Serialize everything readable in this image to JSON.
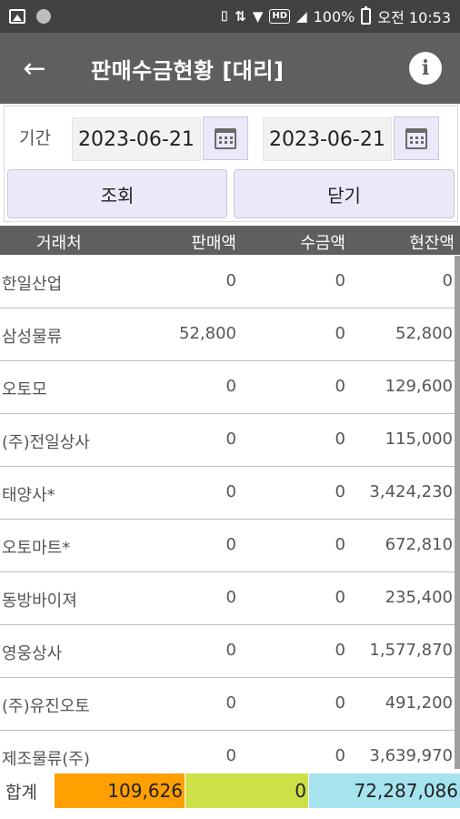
{
  "status_bar": {
    "battery": "100%",
    "time": "오전 10:53",
    "hd_label": "HD"
  },
  "app_bar": {
    "title": "판매수금현황 [대리]",
    "back_icon": "arrow-left-icon",
    "info_icon": "info-icon",
    "info_glyph": "i"
  },
  "filter": {
    "period_label": "기간",
    "start_date": "2023-06-21",
    "end_date": "2023-06-21",
    "search_button": "조회",
    "close_button": "닫기"
  },
  "table": {
    "headers": [
      "거래처",
      "판매액",
      "수금액",
      "현잔액"
    ],
    "rows": [
      {
        "name": "한일산업",
        "sales": "0",
        "collected": "0",
        "balance": "0"
      },
      {
        "name": "삼성물류",
        "sales": "52,800",
        "collected": "0",
        "balance": "52,800"
      },
      {
        "name": "오토모",
        "sales": "0",
        "collected": "0",
        "balance": "129,600"
      },
      {
        "name": "(주)전일상사",
        "sales": "0",
        "collected": "0",
        "balance": "115,000"
      },
      {
        "name": "태양사*",
        "sales": "0",
        "collected": "0",
        "balance": "3,424,230"
      },
      {
        "name": "오토마트*",
        "sales": "0",
        "collected": "0",
        "balance": "672,810"
      },
      {
        "name": "동방바이져",
        "sales": "0",
        "collected": "0",
        "balance": "235,400"
      },
      {
        "name": "영웅상사",
        "sales": "0",
        "collected": "0",
        "balance": "1,577,870"
      },
      {
        "name": "(주)유진오토",
        "sales": "0",
        "collected": "0",
        "balance": "491,200"
      },
      {
        "name": "제조물류(주)",
        "sales": "0",
        "collected": "0",
        "balance": "3,639,970"
      }
    ]
  },
  "totals": {
    "label": "합계",
    "sales": "109,626",
    "collected": "0",
    "balance": "72,287,086",
    "sales_color": "#ff9f00",
    "collected_color": "#cde048",
    "balance_color": "#a5e3ee"
  }
}
